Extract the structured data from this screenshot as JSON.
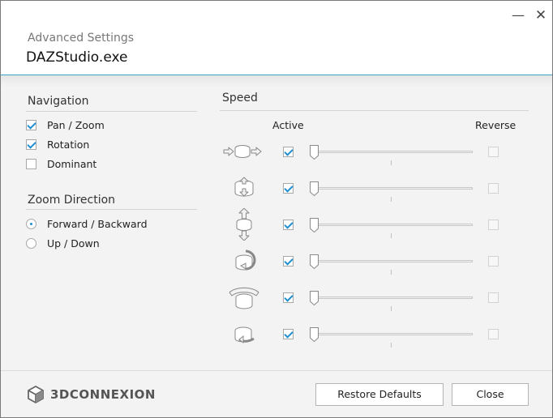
{
  "window": {
    "subtitle": "Advanced Settings",
    "title": "DAZStudio.exe",
    "minimize_glyph": "—",
    "close_glyph": "✕"
  },
  "navigation": {
    "title": "Navigation",
    "options": [
      {
        "label": "Pan / Zoom",
        "checked": true
      },
      {
        "label": "Rotation",
        "checked": true
      },
      {
        "label": "Dominant",
        "checked": false
      }
    ]
  },
  "zoom_direction": {
    "title": "Zoom Direction",
    "options": [
      {
        "label": "Forward / Backward",
        "selected": true
      },
      {
        "label": "Up / Down",
        "selected": false
      }
    ]
  },
  "speed": {
    "title": "Speed",
    "active_header": "Active",
    "reverse_header": "Reverse",
    "axes": [
      {
        "icon": "pan-left-right-icon",
        "active": true,
        "speed": 0,
        "reverse": false
      },
      {
        "icon": "zoom-push-pull-icon",
        "active": true,
        "speed": 0,
        "reverse": false
      },
      {
        "icon": "pan-up-down-icon",
        "active": true,
        "speed": 0,
        "reverse": false
      },
      {
        "icon": "tilt-icon",
        "active": true,
        "speed": 0,
        "reverse": false
      },
      {
        "icon": "roll-icon",
        "active": true,
        "speed": 0,
        "reverse": false
      },
      {
        "icon": "spin-icon",
        "active": true,
        "speed": 0,
        "reverse": false
      }
    ]
  },
  "footer": {
    "logo_text": "3DCONNEXION",
    "restore_label": "Restore Defaults",
    "close_label": "Close"
  },
  "colors": {
    "accent": "#1f8fd1",
    "header_rule": "#37a5c4"
  }
}
